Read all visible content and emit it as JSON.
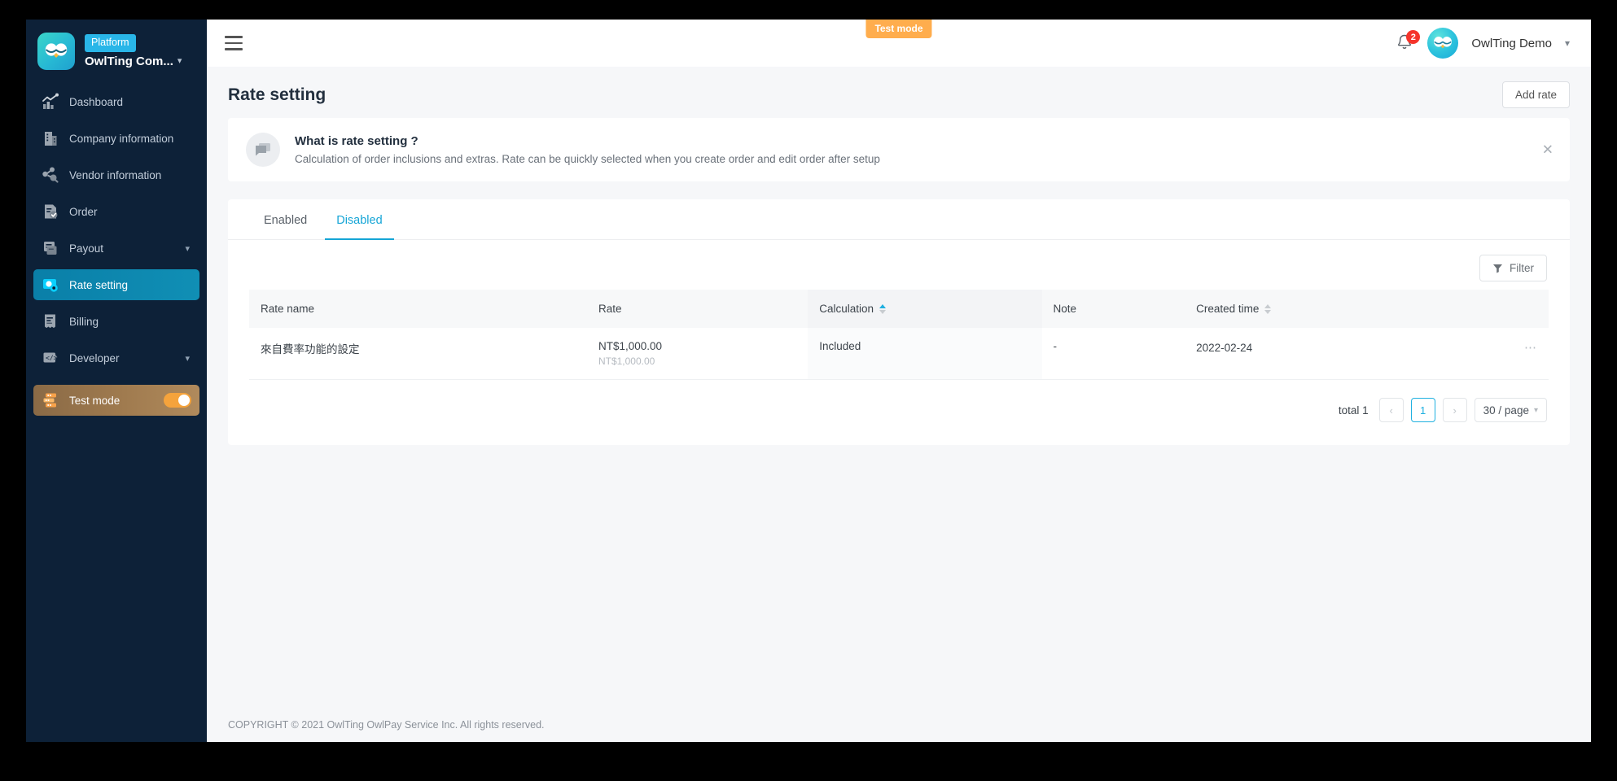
{
  "sidebar": {
    "brand": {
      "badge": "Platform",
      "name": "OwlTing Com...",
      "logo_icon": "owl-logo-icon",
      "chevron_icon": "chevron-down-icon"
    },
    "items": [
      {
        "label": "Dashboard",
        "icon": "chart-growth-icon",
        "active": false,
        "expandable": false
      },
      {
        "label": "Company information",
        "icon": "building-icon",
        "active": false,
        "expandable": false
      },
      {
        "label": "Vendor information",
        "icon": "vendor-network-icon",
        "active": false,
        "expandable": false
      },
      {
        "label": "Order",
        "icon": "order-document-icon",
        "active": false,
        "expandable": false
      },
      {
        "label": "Payout",
        "icon": "payout-cards-icon",
        "active": false,
        "expandable": true
      },
      {
        "label": "Rate setting",
        "icon": "rate-gear-icon",
        "active": true,
        "expandable": false
      },
      {
        "label": "Billing",
        "icon": "billing-receipt-icon",
        "active": false,
        "expandable": false
      },
      {
        "label": "Developer",
        "icon": "code-brackets-icon",
        "active": false,
        "expandable": true
      }
    ],
    "test_mode": {
      "label": "Test mode",
      "icon": "server-stack-icon",
      "enabled": true
    }
  },
  "topbar": {
    "menu_icon": "hamburger-menu-icon",
    "test_mode_pill": "Test mode",
    "notification_icon": "bell-icon",
    "notification_count": "2",
    "user_name": "OwlTing Demo",
    "user_avatar_icon": "owl-avatar-icon",
    "user_chevron_icon": "chevron-down-icon"
  },
  "page": {
    "title": "Rate setting",
    "add_button": "Add rate"
  },
  "info_banner": {
    "icon": "speech-bubble-icon",
    "title": "What is rate setting ?",
    "description": "Calculation of order inclusions and extras. Rate can be quickly selected when you create order and edit order after setup",
    "close_icon": "close-icon"
  },
  "tabs": [
    {
      "label": "Enabled",
      "active": false
    },
    {
      "label": "Disabled",
      "active": true
    }
  ],
  "toolbar": {
    "filter_label": "Filter",
    "filter_icon": "funnel-icon"
  },
  "table": {
    "columns": [
      {
        "label": "Rate name",
        "sortable": false,
        "sort": "none"
      },
      {
        "label": "Rate",
        "sortable": false,
        "sort": "none"
      },
      {
        "label": "Calculation",
        "sortable": true,
        "sort": "asc"
      },
      {
        "label": "Note",
        "sortable": false,
        "sort": "none"
      },
      {
        "label": "Created time",
        "sortable": true,
        "sort": "none"
      }
    ],
    "rows": [
      {
        "rate_name": "來自費率功能的設定",
        "rate_main": "NT$1,000.00",
        "rate_sub": "NT$1,000.00",
        "calculation": "Included",
        "note": "-",
        "created_time": "2022-02-24",
        "actions_icon": "ellipsis-icon"
      }
    ]
  },
  "pagination": {
    "total_label": "total 1",
    "prev_icon": "chevron-left-icon",
    "next_icon": "chevron-right-icon",
    "current_page": "1",
    "page_size": "30 / page",
    "page_size_chevron": "chevron-down-icon"
  },
  "footer": {
    "copyright": "COPYRIGHT © 2021 OwlTing OwlPay Service Inc. All rights reserved."
  },
  "colors": {
    "sidebar_bg": "#0d2138",
    "accent": "#15a5d6",
    "test_mode_orange": "#ffad4d",
    "badge_red": "#f5342b"
  }
}
